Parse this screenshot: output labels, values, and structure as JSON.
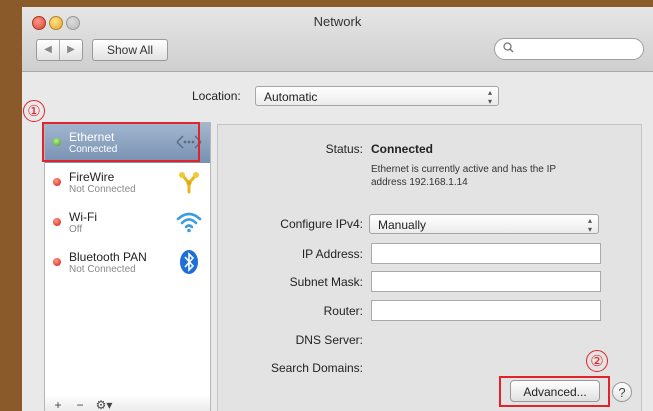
{
  "window": {
    "title": "Network",
    "nav_back": "◀",
    "nav_forward": "▶",
    "show_all_label": "Show All",
    "search_placeholder": ""
  },
  "location": {
    "label": "Location:",
    "value": "Automatic"
  },
  "annotations": {
    "marker_1": "①",
    "marker_2": "②",
    "accent_color": "#e1242c"
  },
  "sidebar": {
    "services": [
      {
        "name": "Ethernet",
        "status": "Connected",
        "indicator": "green",
        "icon": "ethernet-icon",
        "selected": true
      },
      {
        "name": "FireWire",
        "status": "Not Connected",
        "indicator": "red",
        "icon": "firewire-icon",
        "selected": false
      },
      {
        "name": "Wi-Fi",
        "status": "Off",
        "indicator": "red",
        "icon": "wifi-icon",
        "selected": false
      },
      {
        "name": "Bluetooth PAN",
        "status": "Not Connected",
        "indicator": "red",
        "icon": "bluetooth-icon",
        "selected": false
      }
    ],
    "add_label": "+",
    "remove_label": "−",
    "gear_label": "⚙▾"
  },
  "detail": {
    "status_label": "Status:",
    "status_value": "Connected",
    "status_description": "Ethernet is currently active and has the IP address 192.168.1.14",
    "configure_label": "Configure IPv4:",
    "configure_value": "Manually",
    "ip_label": "IP Address:",
    "ip_value": "",
    "subnet_label": "Subnet Mask:",
    "subnet_value": "",
    "router_label": "Router:",
    "router_value": "",
    "dns_label": "DNS Server:",
    "search_domains_label": "Search Domains:",
    "advanced_label": "Advanced...",
    "help_label": "?"
  }
}
